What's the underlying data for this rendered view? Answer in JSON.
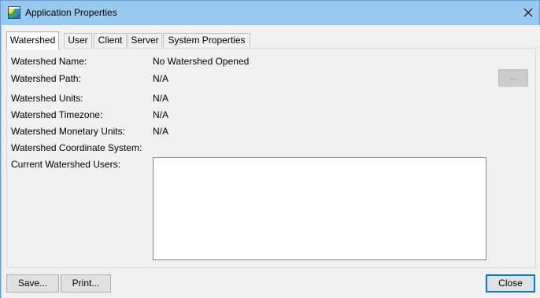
{
  "window": {
    "title": "Application Properties"
  },
  "tabs": [
    {
      "label": "Watershed",
      "active": true
    },
    {
      "label": "User",
      "active": false
    },
    {
      "label": "Client",
      "active": false
    },
    {
      "label": "Server",
      "active": false
    },
    {
      "label": "System Properties",
      "active": false
    }
  ],
  "fields": {
    "name_label": "Watershed Name:",
    "name_value": "No Watershed Opened",
    "path_label": "Watershed Path:",
    "path_value": "N/A",
    "browse_label": "...",
    "units_label": "Watershed Units:",
    "units_value": "N/A",
    "timezone_label": "Watershed Timezone:",
    "timezone_value": "N/A",
    "monetary_label": "Watershed Monetary Units:",
    "monetary_value": "N/A",
    "coord_label": "Watershed Coordinate System:",
    "coord_value": "",
    "users_label": "Current Watershed Users:"
  },
  "footer": {
    "save_label": "Save...",
    "print_label": "Print...",
    "close_label": "Close"
  },
  "colors": {
    "titlebar": "#99c9ef",
    "client": "#f0f0f0",
    "default_button_border": "#0078d7"
  },
  "icons": {
    "app": "app-window-icon",
    "close": "close-icon"
  }
}
